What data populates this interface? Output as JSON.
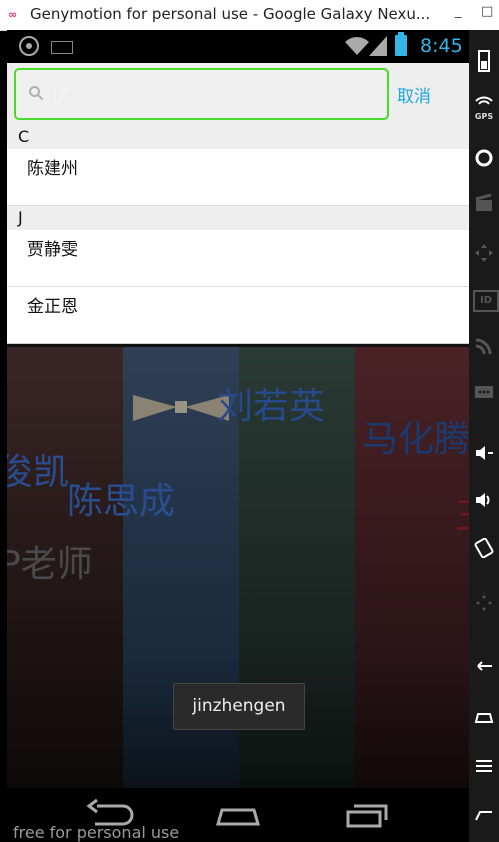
{
  "window": {
    "title": "Genymotion for personal use - Google Galaxy Nexu...",
    "minimize": "_",
    "maximize": "□"
  },
  "statusbar": {
    "time": "8:45",
    "accent": "#33b5e5"
  },
  "search": {
    "query": "jz",
    "cancel_label": "取消",
    "focus_color": "#4cdb2a"
  },
  "contacts": [
    {
      "letter": "C",
      "names": [
        "陈建州"
      ]
    },
    {
      "letter": "J",
      "names": [
        "贾静雯",
        "金正恩"
      ]
    }
  ],
  "background_names": [
    "刘若英",
    "马化腾",
    "陈思成",
    "俊凯",
    "P老师",
    "王"
  ],
  "toast": {
    "text": "jinzhengen"
  },
  "watermark": "free for personal use",
  "toolbar": {
    "gps_label": "GPS",
    "id_label": "ID"
  },
  "icons": [
    "gps-icon",
    "keyboard-icon",
    "wifi-icon",
    "signal-icon",
    "battery-icon",
    "search-icon",
    "back-icon",
    "home-icon",
    "recent-apps-icon",
    "camera-icon",
    "clapper-icon",
    "dpad-icon",
    "rss-icon",
    "sms-icon",
    "volume-down-icon",
    "volume-up-icon",
    "rotate-icon",
    "menu-icon"
  ]
}
